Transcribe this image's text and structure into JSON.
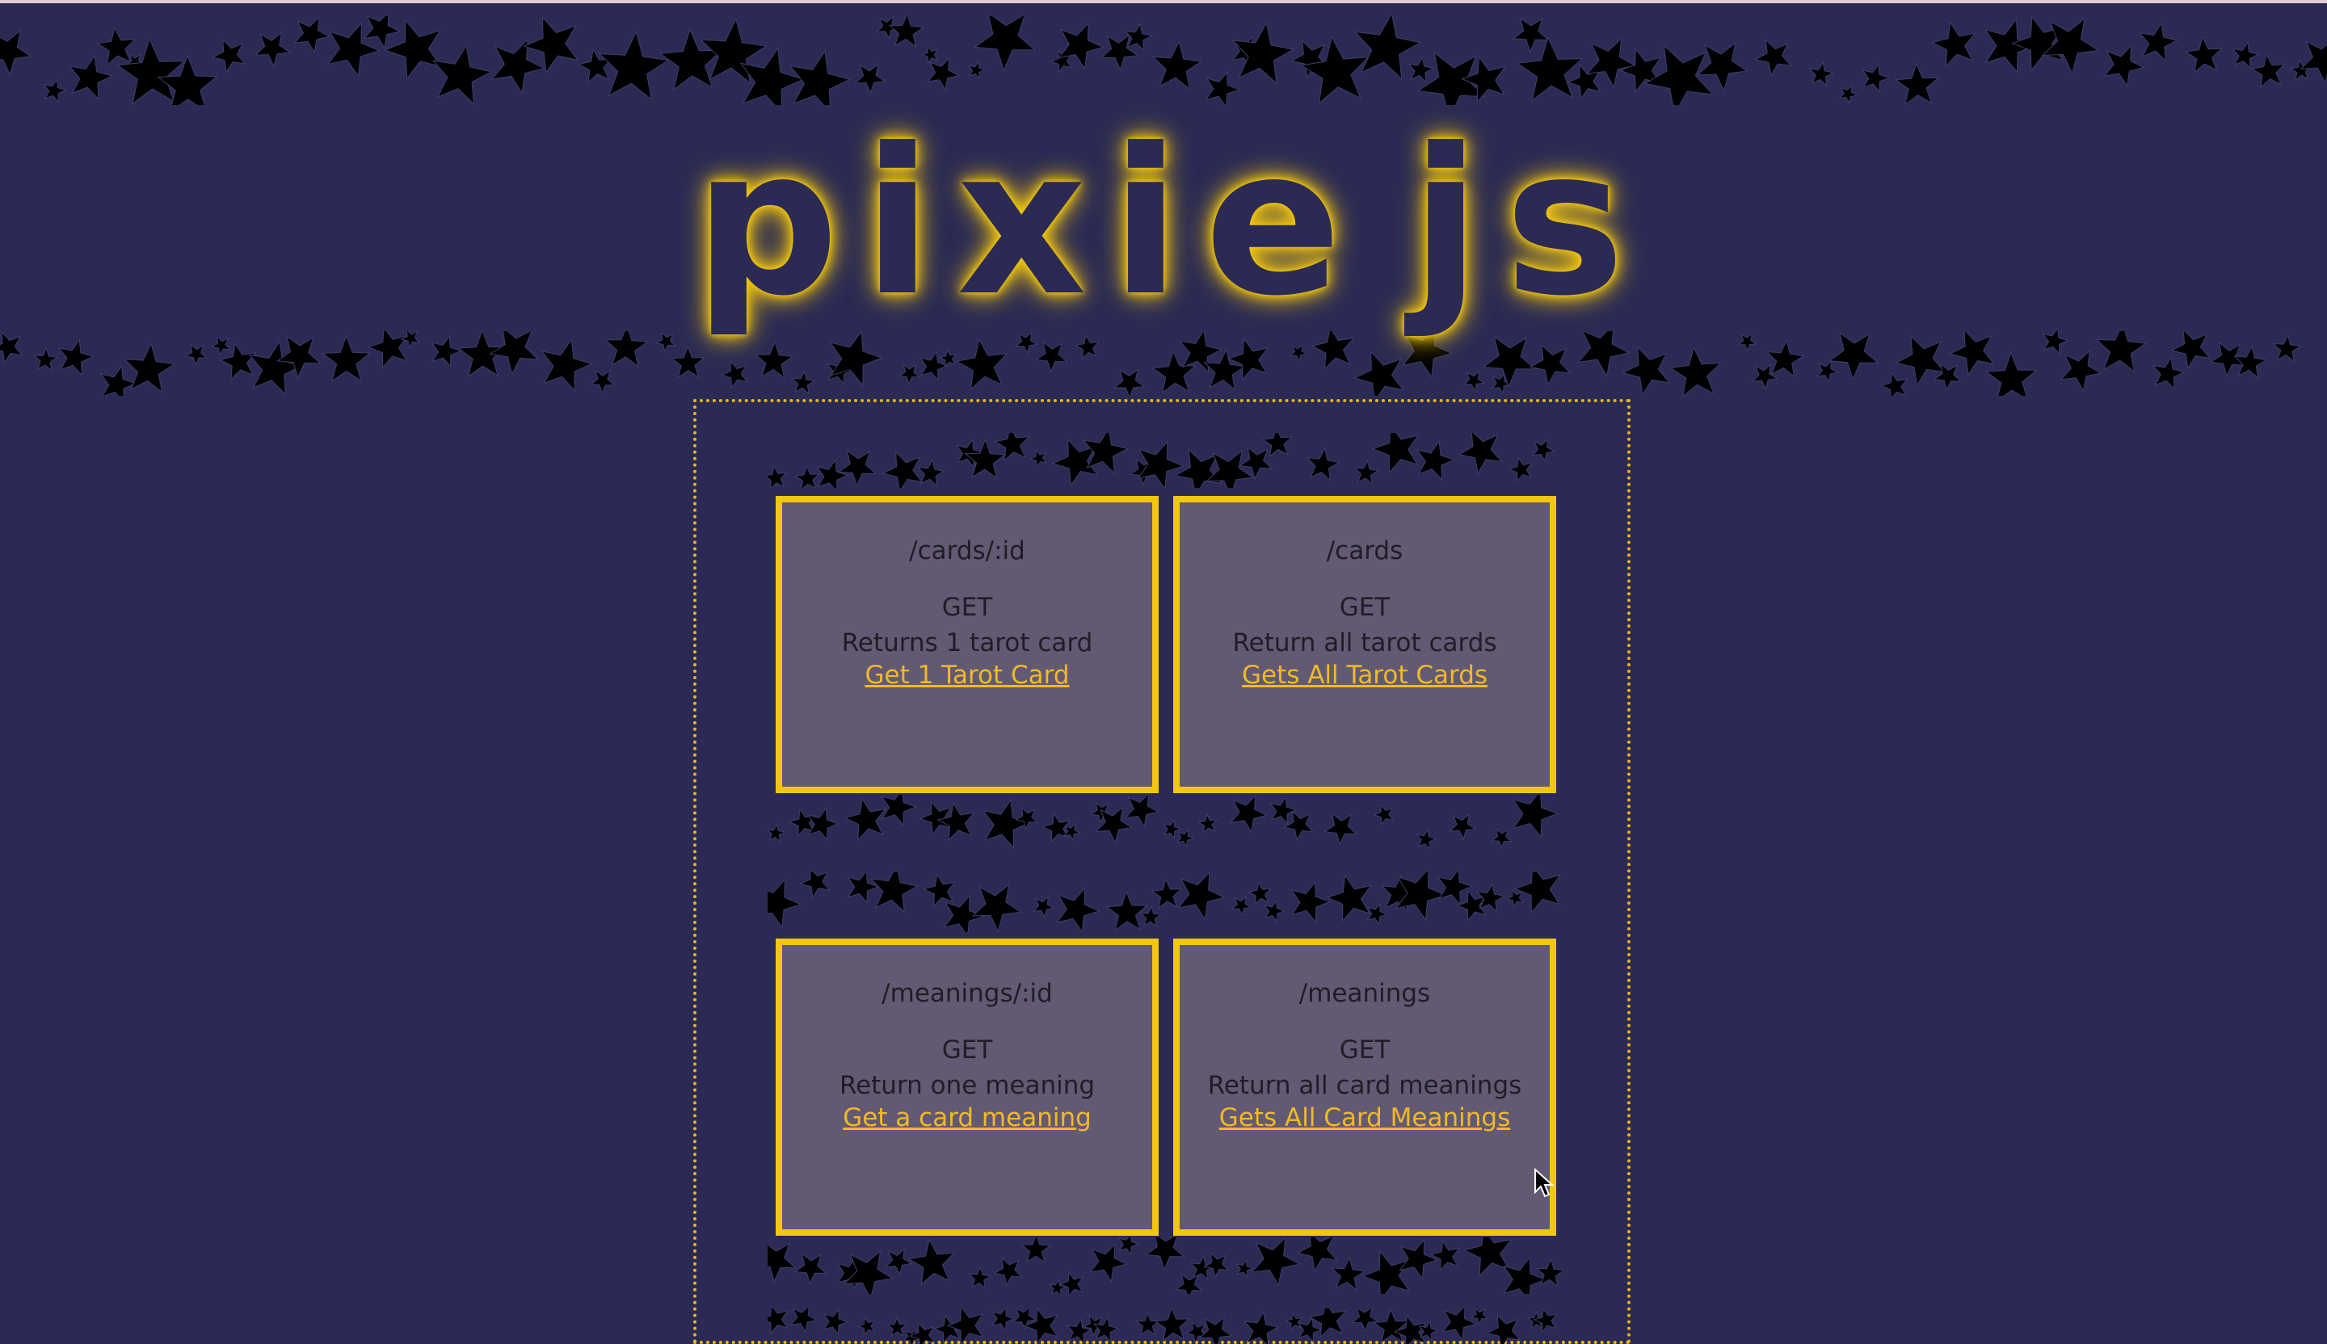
{
  "logo": {
    "before": "pixie",
    "after": "js",
    "moon": "moon-dot"
  },
  "cards": [
    {
      "path": "/cards/:id",
      "method": "GET",
      "description": "Returns 1 tarot card",
      "link": "Get 1 Tarot Card"
    },
    {
      "path": "/cards",
      "method": "GET",
      "description": "Return all tarot cards",
      "link": "Gets All Tarot Cards"
    },
    {
      "path": "/meanings/:id",
      "method": "GET",
      "description": "Return one meaning",
      "link": "Get a card meaning"
    },
    {
      "path": "/meanings",
      "method": "GET",
      "description": "Return all card meanings",
      "link": "Gets All Card Meanings"
    }
  ],
  "colors": {
    "background": "#2a2a54",
    "accent": "#f2c711",
    "card": "#625a73",
    "link": "#f2b827"
  }
}
